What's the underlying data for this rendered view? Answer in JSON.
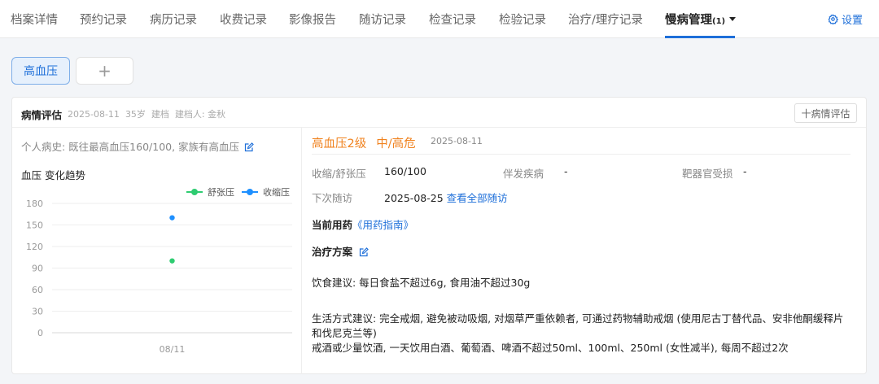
{
  "nav": {
    "tabs": [
      {
        "label": "档案详情"
      },
      {
        "label": "预约记录"
      },
      {
        "label": "病历记录"
      },
      {
        "label": "收费记录"
      },
      {
        "label": "影像报告"
      },
      {
        "label": "随访记录"
      },
      {
        "label": "检查记录"
      },
      {
        "label": "检验记录"
      },
      {
        "label": "治疗/理疗记录"
      }
    ],
    "active_tab": {
      "label": "慢病管理",
      "count": "(1)"
    },
    "settings_label": "设置"
  },
  "disease_chips": {
    "selected": "高血压",
    "add_label": "+"
  },
  "assessment": {
    "title": "病情评估",
    "date": "2025-08-11",
    "age": "35岁",
    "status": "建档",
    "creator": "建档人: 金秋",
    "add_button": "十病情评估",
    "history": "个人病史: 既往最高血压160/100, 家族有高血压",
    "trend_title": "血压 变化趋势",
    "diagnosis": "高血压2级",
    "risk": "中/高危",
    "diagnosis_date": "2025-08-11",
    "bp_label": "收缩/舒张压",
    "bp_value": "160/100",
    "comorbid_label": "伴发疾病",
    "comorbid_value": "-",
    "organ_label": "靶器官受损",
    "organ_value": "-",
    "followup_label": "下次随访",
    "followup_value": "2025-08-25",
    "followup_link": "查看全部随访",
    "medication_label": "当前用药",
    "medication_link": "《用药指南》",
    "plan_label": "治疗方案",
    "diet": "饮食建议: 每日食盐不超过6g, 食用油不超过30g",
    "lifestyle": "生活方式建议: 完全戒烟, 避免被动吸烟, 对烟草严重依赖者, 可通过药物辅助戒烟 (使用尼古丁替代品、安非他酮缓释片和伐尼克兰等)",
    "alcohol": "戒酒或少量饮酒, 一天饮用白酒、葡萄酒、啤酒不超过50ml、100ml、250ml (女性减半), 每周不超过2次"
  },
  "chart_data": {
    "type": "scatter",
    "categories": [
      "08/11"
    ],
    "series": [
      {
        "name": "舒张压",
        "values": [
          100
        ],
        "color": "#2ecc71"
      },
      {
        "name": "收缩压",
        "values": [
          160
        ],
        "color": "#1e90ff"
      }
    ],
    "yticks": [
      0,
      30,
      60,
      90,
      120,
      150,
      180
    ],
    "ylim": [
      0,
      180
    ],
    "grid": true,
    "legend": "top-right"
  }
}
